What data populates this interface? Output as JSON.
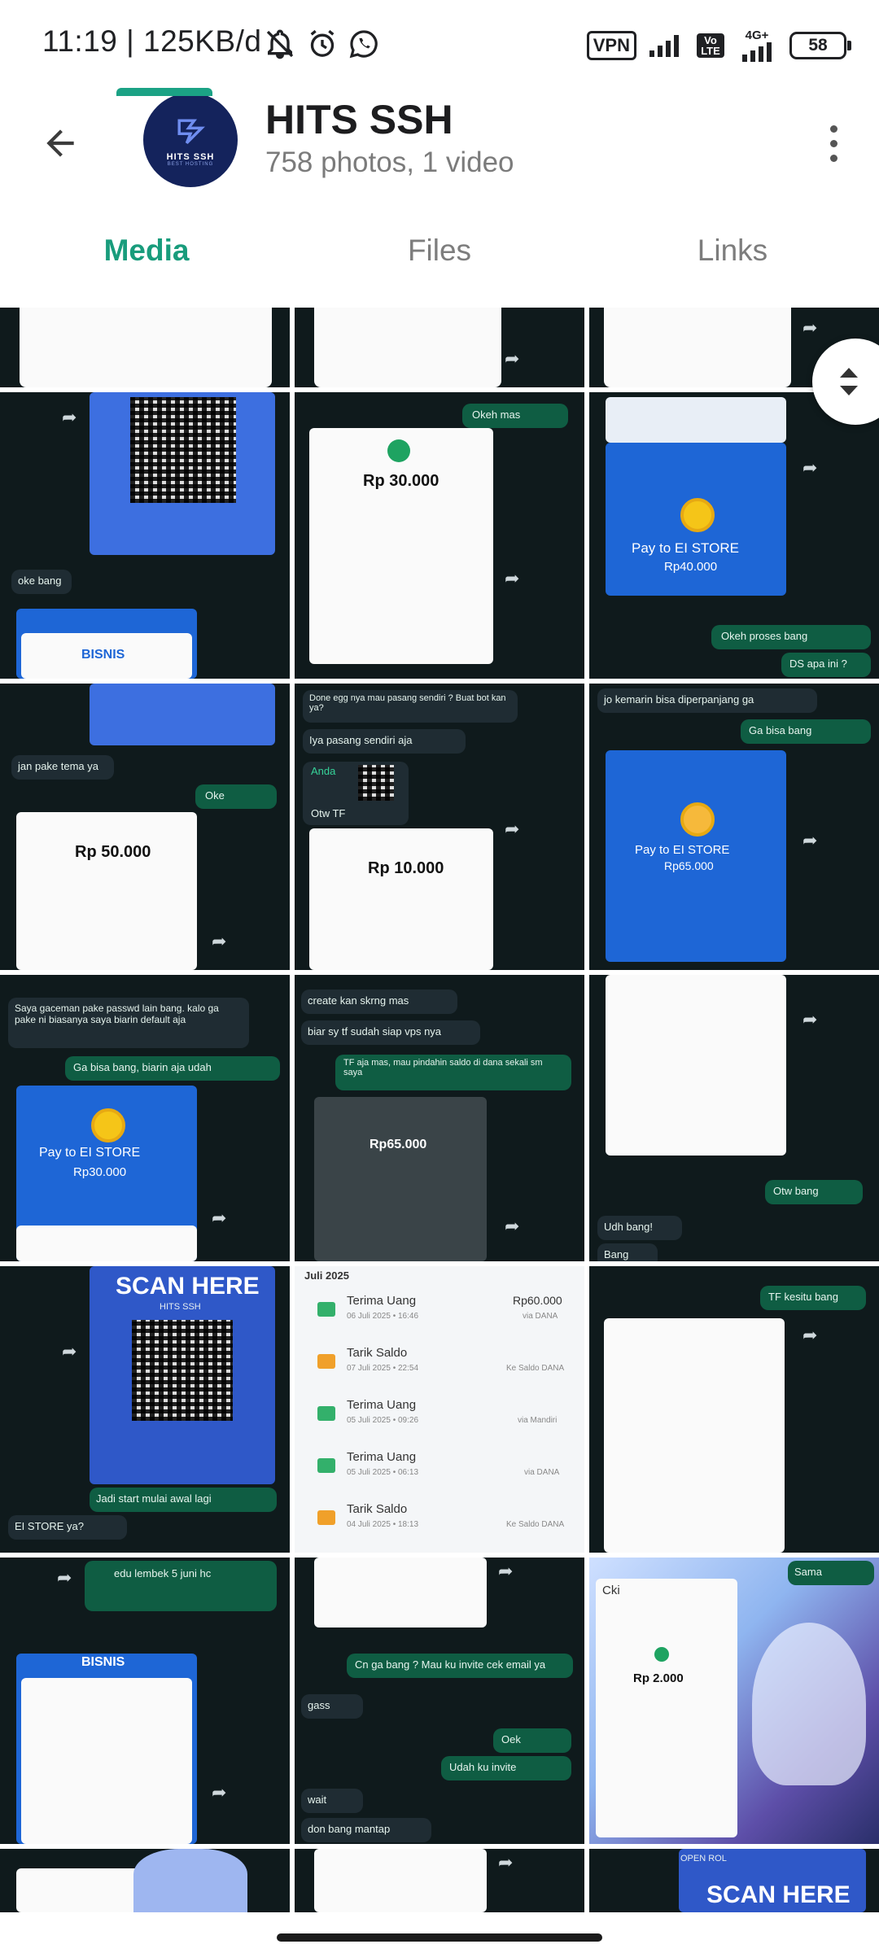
{
  "status_bar": {
    "time_speed": "11:19 | 125KB/d",
    "vpn": "VPN",
    "volte": "Vo LTE",
    "network": "4G+",
    "battery": "58"
  },
  "header": {
    "title": "HITS SSH",
    "subtitle": "758 photos, 1 video",
    "avatar_text": "HITS SSH",
    "avatar_subtext": "BEST HOSTING"
  },
  "tabs": [
    {
      "label": "Media",
      "active": true
    },
    {
      "label": "Files",
      "active": false
    },
    {
      "label": "Links",
      "active": false
    }
  ],
  "media_tiles": {
    "r1c2": {
      "amount": "Rp 30.000"
    },
    "r1c3": {
      "pay": "Pay to EI STORE",
      "amount": "Rp40.000",
      "msg1": "Okeh proses bang",
      "msg2": "DS apa ini ?"
    },
    "r1c1": {
      "msg": "oke bang",
      "brand": "BISNIS"
    },
    "r1c2b": {
      "msg": "Okeh mas"
    },
    "r2c1": {
      "msg1": "jan pake tema ya",
      "msg2": "Oke",
      "amount": "Rp 50.000"
    },
    "r2c2": {
      "msg1": "Done egg nya mau pasang sendiri ? Buat bot kan ya?",
      "msg2": "Iya pasang sendiri aja",
      "msg3": "Anda",
      "msg4": "Otw TF",
      "amount": "Rp 10.000"
    },
    "r2c3": {
      "msg1": "jo kemarin bisa diperpanjang ga",
      "msg2": "Ga bisa bang",
      "pay": "Pay to EI STORE",
      "amount": "Rp65.000"
    },
    "r3c1": {
      "msg1": "Saya gaceman pake passwd lain bang. kalo ga pake ni biasanya saya biarin default aja",
      "msg2": "Ga bisa bang, biarin aja udah",
      "pay": "Pay to EI STORE",
      "amount": "Rp30.000"
    },
    "r3c2": {
      "msg1": "create kan skrng mas",
      "msg2": "biar sy tf sudah siap vps nya",
      "msg3": "TF aja mas, mau pindahin saldo di dana sekali sm saya",
      "amount": "Rp65.000"
    },
    "r3c3": {
      "msg1": "Otw bang",
      "msg2": "Udh bang!",
      "msg3": "Bang"
    },
    "r4c1": {
      "title": "SCAN HERE",
      "sub": "HITS SSH",
      "msg1": "Jadi start mulai awal lagi",
      "msg2": "EI STORE ya?"
    },
    "r4c2": {
      "month": "Juli 2025",
      "rows": [
        {
          "label": "Terima Uang",
          "date": "06 Juli 2025 • 16:46",
          "value": "Rp60.000",
          "via": "via DANA"
        },
        {
          "label": "Tarik Saldo",
          "date": "07 Juli 2025 • 22:54",
          "value": "",
          "via": "Ke Saldo DANA"
        },
        {
          "label": "Terima Uang",
          "date": "05 Juli 2025 • 09:26",
          "value": "",
          "via": "via Mandiri"
        },
        {
          "label": "Terima Uang",
          "date": "05 Juli 2025 • 06:13",
          "value": "",
          "via": "via DANA"
        },
        {
          "label": "Tarik Saldo",
          "date": "04 Juli 2025 • 18:13",
          "value": "",
          "via": "Ke Saldo DANA"
        }
      ]
    },
    "r4c3": {
      "msg": "TF kesitu bang"
    },
    "r5c1": {
      "msg1": "edu lembek 5 juni hc",
      "brand": "BISNIS"
    },
    "r5c2": {
      "msg1": "Cn ga bang ? Mau ku invite cek email ya",
      "msg2": "gass",
      "msg3": "Oek",
      "msg4": "Udah ku invite",
      "msg5": "wait",
      "msg6": "don bang mantap"
    },
    "r5c3": {
      "msg1": "Sama",
      "msg2": "Cki",
      "amount": "Rp 2.000"
    },
    "r6c3": {
      "msg1": "OPEN ROL",
      "title": "SCAN HERE"
    }
  }
}
